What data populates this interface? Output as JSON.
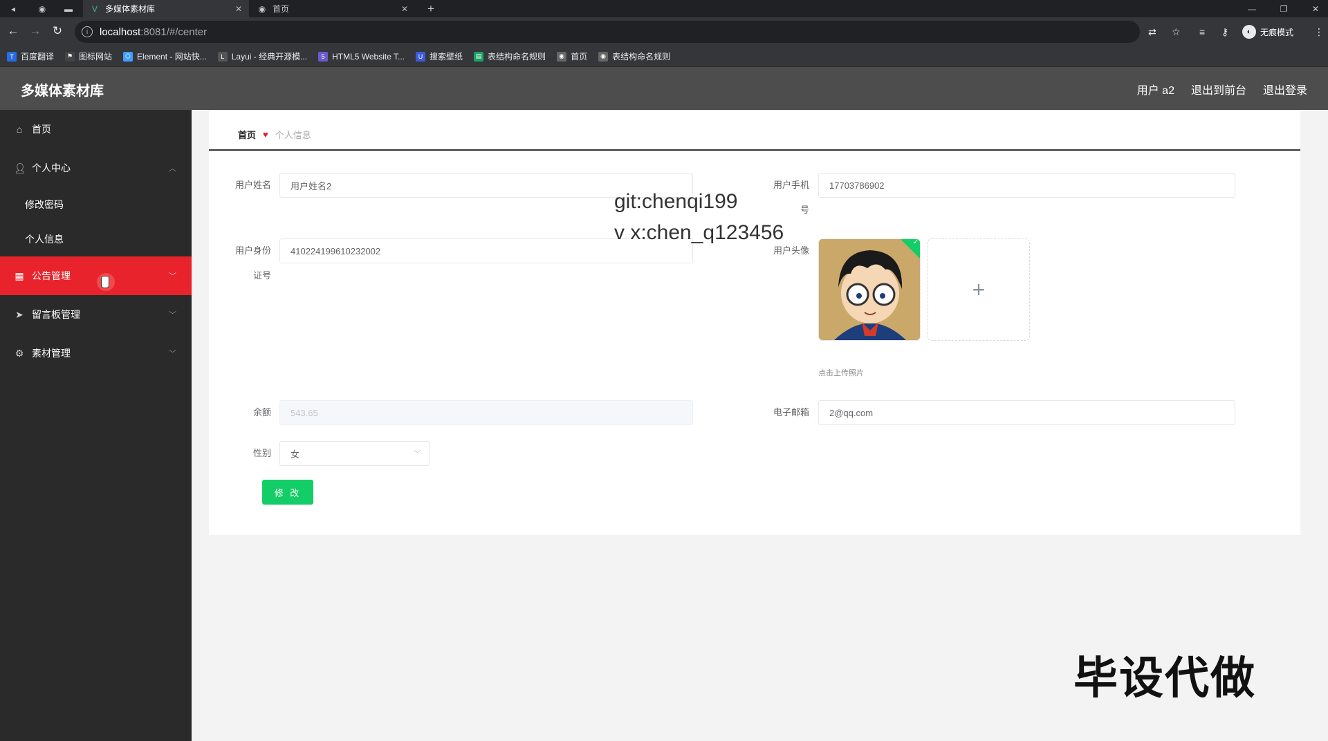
{
  "browser": {
    "tabs": [
      {
        "title": "多媒体素材库",
        "active": true
      },
      {
        "title": "首页",
        "active": false
      }
    ],
    "new_tab": "+",
    "url_host": "localhost",
    "url_rest": ":8081/#/center",
    "incognito_label": "无痕模式",
    "bookmarks": [
      {
        "label": "百度翻译",
        "icon": "translate-icon",
        "color": "#2a6be3"
      },
      {
        "label": "图标网站",
        "icon": "flag-icon",
        "color": "#444444"
      },
      {
        "label": "Element - 网站快...",
        "icon": "element-icon",
        "color": "#409eff"
      },
      {
        "label": "Layui - 经典开源模...",
        "icon": "layui-icon",
        "color": "#555555"
      },
      {
        "label": "HTML5 Website T...",
        "icon": "html5-icon",
        "color": "#6a5acd"
      },
      {
        "label": "搜索壁纸",
        "icon": "wallpaper-icon",
        "color": "#3b5bdb"
      },
      {
        "label": "表结构命名规则",
        "icon": "sheet-icon",
        "color": "#1aa260"
      },
      {
        "label": "首页",
        "icon": "globe-icon",
        "color": "#666666"
      },
      {
        "label": "表结构命名规则",
        "icon": "globe-icon",
        "color": "#666666"
      }
    ]
  },
  "header": {
    "brand": "多媒体素材库",
    "user": "用户 a2",
    "back_to_front": "退出到前台",
    "logout": "退出登录"
  },
  "sidebar": {
    "items": [
      {
        "label": "首页",
        "icon": "home-icon"
      },
      {
        "label": "个人中心",
        "icon": "user-icon",
        "expanded": true
      },
      {
        "label": "修改密码",
        "sub": true
      },
      {
        "label": "个人信息",
        "sub": true
      },
      {
        "label": "公告管理",
        "icon": "calendar-icon",
        "active": true
      },
      {
        "label": "留言板管理",
        "icon": "send-icon"
      },
      {
        "label": "素材管理",
        "icon": "gear-icon"
      }
    ]
  },
  "breadcrumb": {
    "home": "首页",
    "current": "个人信息"
  },
  "form": {
    "name_label": "用户姓名",
    "name_value": "用户姓名2",
    "phone_label_1": "用户手机",
    "phone_label_2": "号",
    "phone_value": "17703786902",
    "id_label_1": "用户身份",
    "id_label_2": "证号",
    "id_value": "410224199610232002",
    "avatar_label": "用户头像",
    "upload_tip": "点击上传照片",
    "balance_label": "余额",
    "balance_value": "543.65",
    "email_label": "电子邮箱",
    "email_value": "2@qq.com",
    "gender_label": "性别",
    "gender_value": "女",
    "submit_label": "修 改"
  },
  "watermark": {
    "line1": "git:chenqi199",
    "line2": "v x:chen_q123456",
    "big": "毕设代做"
  },
  "colors": {
    "sidebar_bg": "#2a2a2a",
    "active_menu": "#e8232b",
    "header_bg": "#4d4d4d",
    "submit_btn": "#13ce66"
  }
}
